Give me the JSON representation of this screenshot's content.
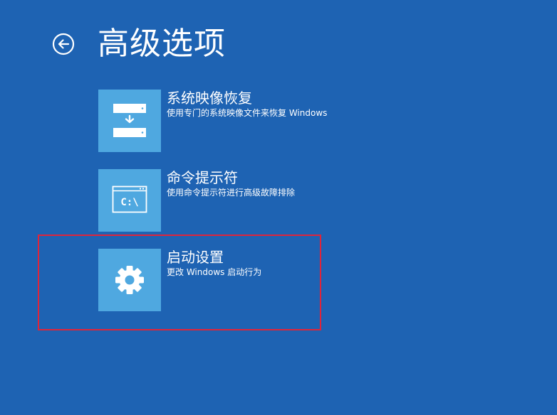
{
  "header": {
    "title": "高级选项",
    "back_icon": "back-arrow-icon"
  },
  "options": [
    {
      "title": "系统映像恢复",
      "description": "使用专门的系统映像文件来恢复 Windows",
      "icon": "system-image-recovery-icon"
    },
    {
      "title": "命令提示符",
      "description": "使用命令提示符进行高级故障排除",
      "icon": "command-prompt-icon",
      "icon_text": "C:\\"
    },
    {
      "title": "启动设置",
      "description": "更改 Windows 启动行为",
      "icon": "gear-icon"
    }
  ],
  "colors": {
    "background": "#1e63b3",
    "tile": "#4fa8e0",
    "text": "#ffffff",
    "highlight": "#e0243a"
  }
}
